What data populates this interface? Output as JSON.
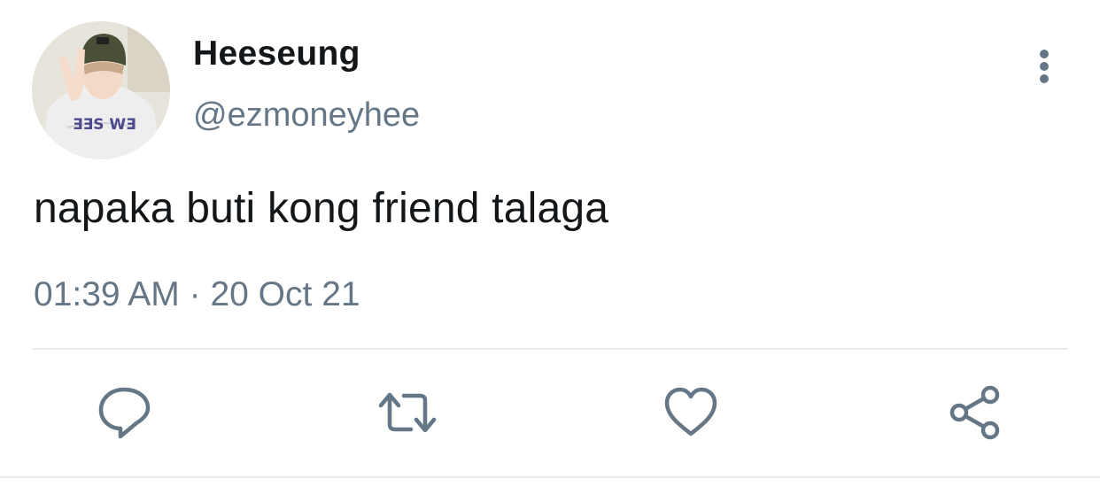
{
  "tweet": {
    "display_name": "Heeseung",
    "handle": "@ezmoneyhee",
    "text": "napaka buti kong friend talaga",
    "time": "01:39 AM",
    "separator": "·",
    "date": "20 Oct 21",
    "avatar_text": "ƎƎS WƎ"
  },
  "icons": {
    "more": "more-vertical-icon",
    "reply": "reply-icon",
    "retweet": "retweet-icon",
    "like": "heart-icon",
    "share": "share-icon"
  },
  "colors": {
    "text_primary": "#14171a",
    "text_secondary": "#657786",
    "icon": "#657786",
    "divider": "#e6ecf0"
  }
}
